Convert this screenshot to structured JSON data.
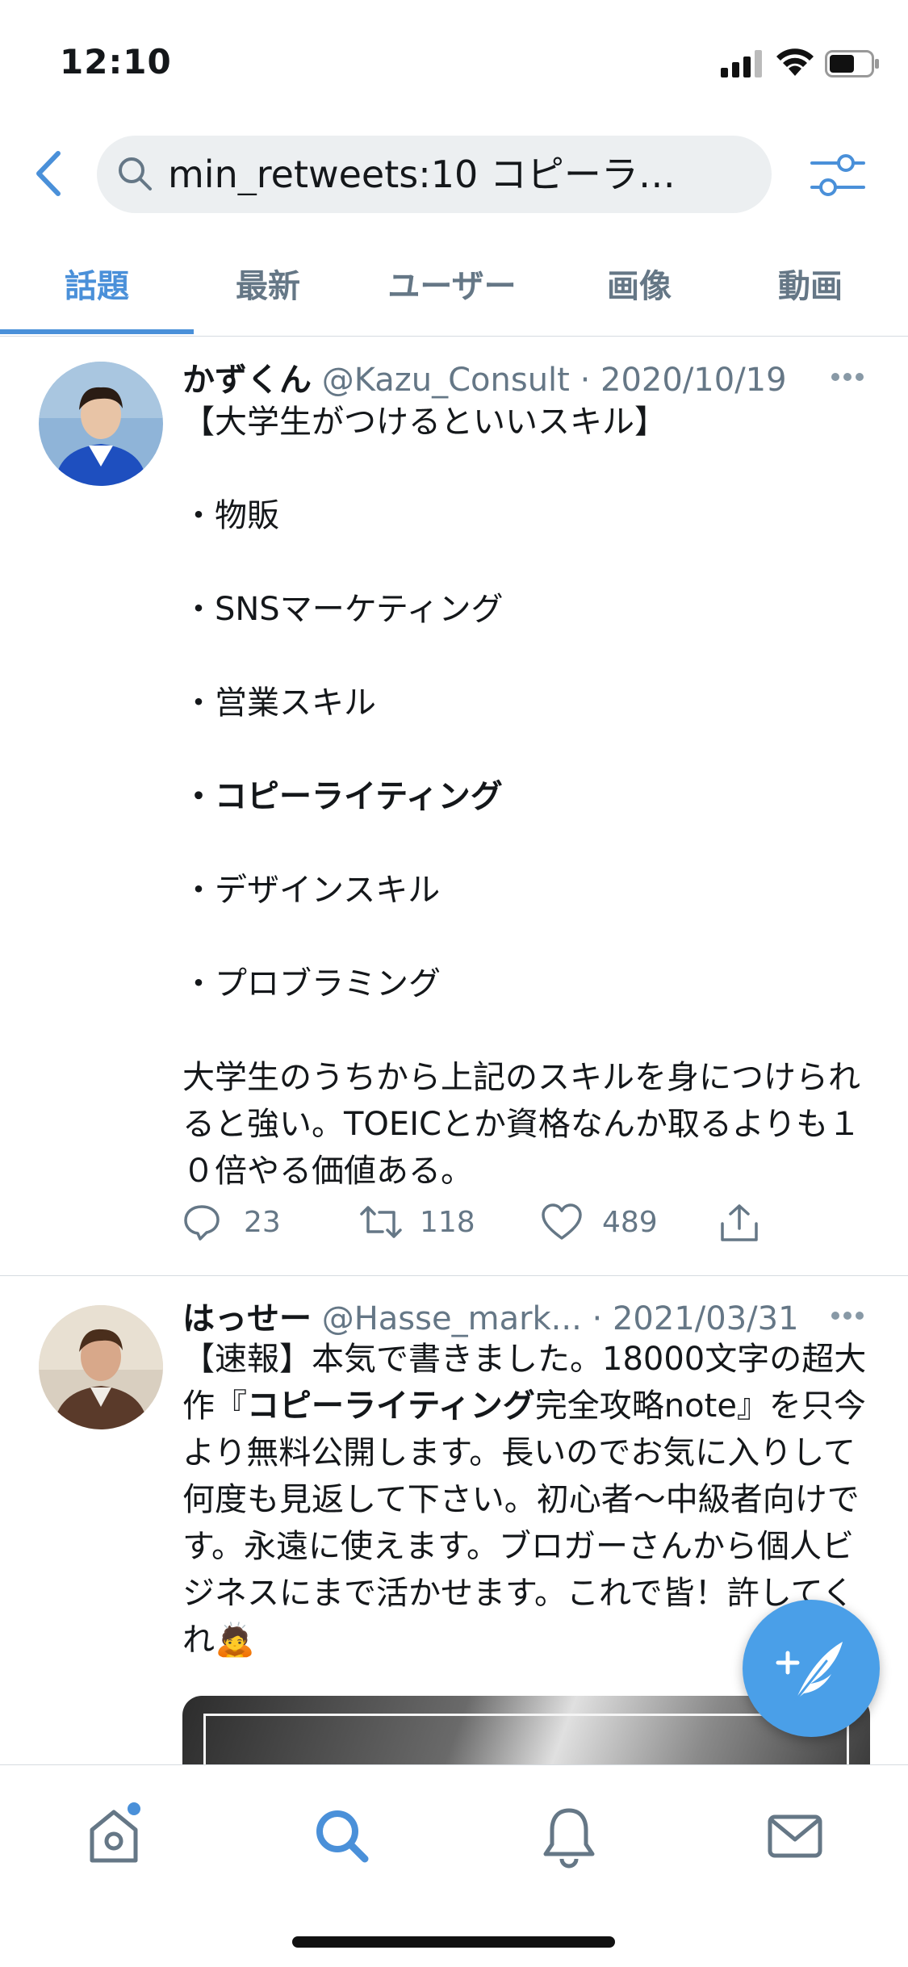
{
  "status_bar": {
    "time": "12:10"
  },
  "search": {
    "query": "min_retweets:10 コピーラ…"
  },
  "tabs": [
    {
      "label": "話題",
      "active": true
    },
    {
      "label": "最新",
      "active": false
    },
    {
      "label": "ユーザー",
      "active": false
    },
    {
      "label": "画像",
      "active": false
    },
    {
      "label": "動画",
      "active": false
    }
  ],
  "tweets": [
    {
      "name": "かずくん",
      "handle": "@Kazu_Consult",
      "date": "2020/10/19",
      "lines": [
        "【大学生がつけるといいスキル】",
        "・物販",
        "・SNSマーケティング",
        "・営業スキル",
        "・コピーライティング",
        "・デザインスキル",
        "・プロブラミング",
        "大学生のうちから上記のスキルを身につけられると強い。TOEICとか資格なんか取るよりも１０倍やる価値ある。"
      ],
      "replies": "23",
      "retweets": "118",
      "likes": "489"
    },
    {
      "name": "はっせー",
      "handle": "@Hasse_mark...",
      "date": "2021/03/31",
      "text_before": "【速報】本気で書きました。18000文字の超大作『",
      "text_bold": "コピーライティング",
      "text_after": "完全攻略note』を只今より無料公開します。長いのでお気に入りして何度も見返して下さい。初心者〜中級者向けです。永遠に使えます。ブロガーさんから個人ビジネスにまで活かせます。これで皆！許してくれ🙇"
    }
  ],
  "colors": {
    "accent": "#4a90d9",
    "secondary_text": "#657786",
    "fab": "#4a9fe8"
  },
  "icons": [
    "back-icon",
    "search-icon",
    "filter-icon",
    "more-icon",
    "reply-icon",
    "retweet-icon",
    "like-icon",
    "share-icon",
    "compose-icon",
    "home-icon",
    "explore-icon",
    "notifications-icon",
    "messages-icon"
  ]
}
